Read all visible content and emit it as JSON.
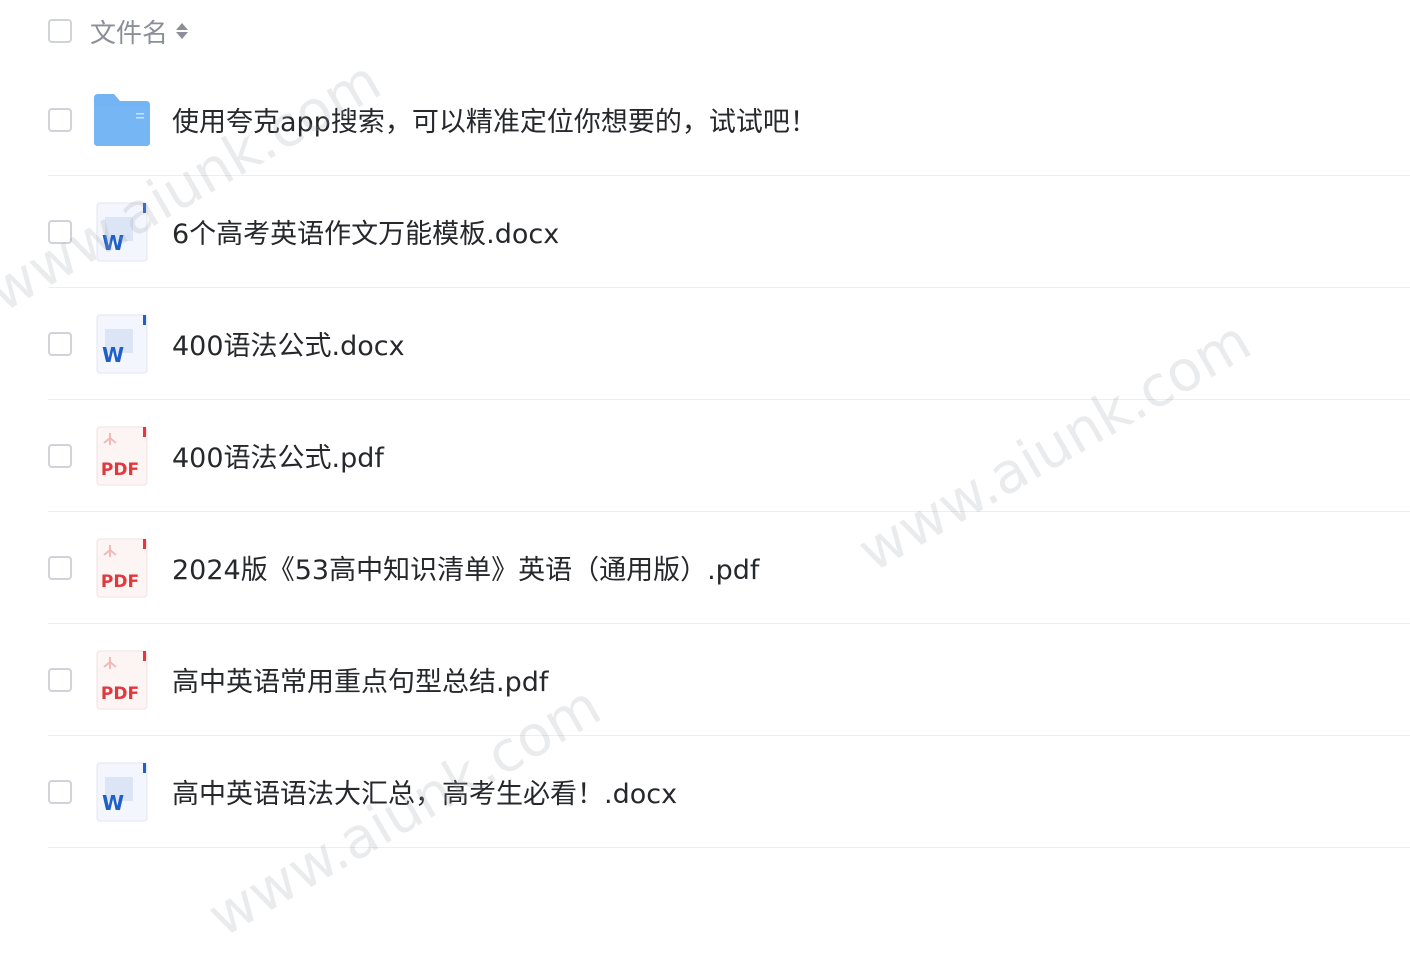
{
  "header": {
    "column_label": "文件名",
    "sort_icon": "sort-icon"
  },
  "files": [
    {
      "name": "使用夸克app搜索，可以精准定位你想要的，试试吧！",
      "type": "folder",
      "icon": "folder-icon"
    },
    {
      "name": "6个高考英语作文万能模板.docx",
      "type": "docx",
      "icon": "word-doc-icon"
    },
    {
      "name": "400语法公式.docx",
      "type": "docx",
      "icon": "word-doc-icon"
    },
    {
      "name": "400语法公式.pdf",
      "type": "pdf",
      "icon": "pdf-icon"
    },
    {
      "name": "2024版《53高中知识清单》英语（通用版）.pdf",
      "type": "pdf",
      "icon": "pdf-icon"
    },
    {
      "name": "高中英语常用重点句型总结.pdf",
      "type": "pdf",
      "icon": "pdf-icon"
    },
    {
      "name": "高中英语语法大汇总，高考生必看！.docx",
      "type": "docx",
      "icon": "word-doc-icon"
    }
  ],
  "icon_labels": {
    "word": "W",
    "pdf": "PDF"
  },
  "watermarks": [
    "www.aiunk.com",
    "www.aiunk.com",
    "www.aiunk.com"
  ],
  "colors": {
    "folder": "#5aa7f2",
    "word": "#1e5fc9",
    "pdf": "#e0383c"
  }
}
